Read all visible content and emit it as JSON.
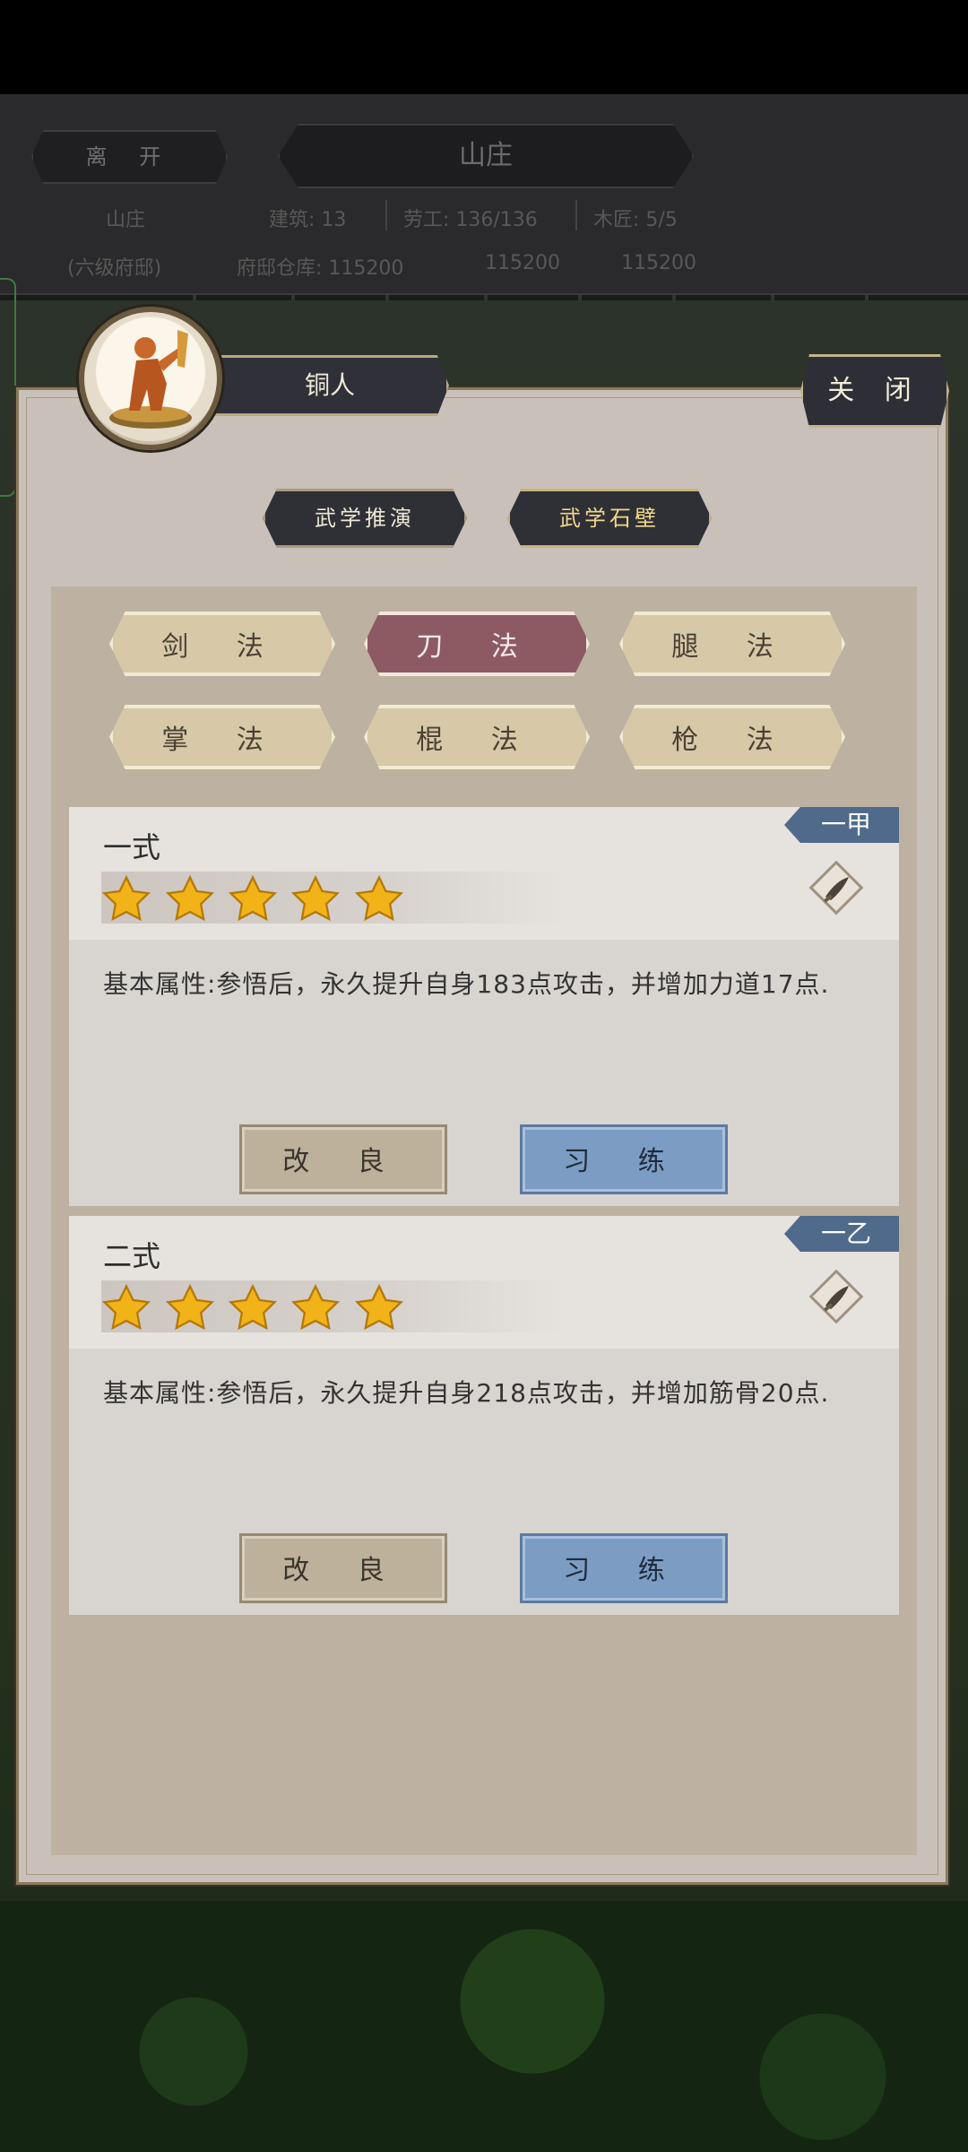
{
  "hud": {
    "leave": "离 开",
    "title": "山庄",
    "location": "山庄",
    "location_sub": "(六级府邸)",
    "buildings": "建筑: 13",
    "laborers": "劳工: 136/136",
    "carpenters": "木匠: 5/5",
    "warehouse": "府邸仓库: 115200",
    "res2": "115200",
    "res3": "115200"
  },
  "panel": {
    "name": "铜人",
    "close": "关 闭",
    "subtabs": [
      "武学推演",
      "武学石壁"
    ],
    "categories": [
      "剑 法",
      "刀 法",
      "腿 法",
      "掌 法",
      "棍 法",
      "枪 法"
    ],
    "active_category": "刀 法"
  },
  "cards": [
    {
      "title": "一式",
      "grade": "一甲",
      "stars": 5,
      "desc": "基本属性:参悟后，永久提升自身183点攻击，并增加力道17点.",
      "improve": "改 良",
      "practice": "习 练"
    },
    {
      "title": "二式",
      "grade": "一乙",
      "stars": 5,
      "desc": "基本属性:参悟后，永久提升自身218点攻击，并增加筋骨20点.",
      "improve": "改 良",
      "practice": "习 练"
    }
  ],
  "colors": {
    "active_tab": "#8d5a63",
    "practice_button": "#7c9cc4",
    "grade_badge": "#4f6a8a"
  }
}
